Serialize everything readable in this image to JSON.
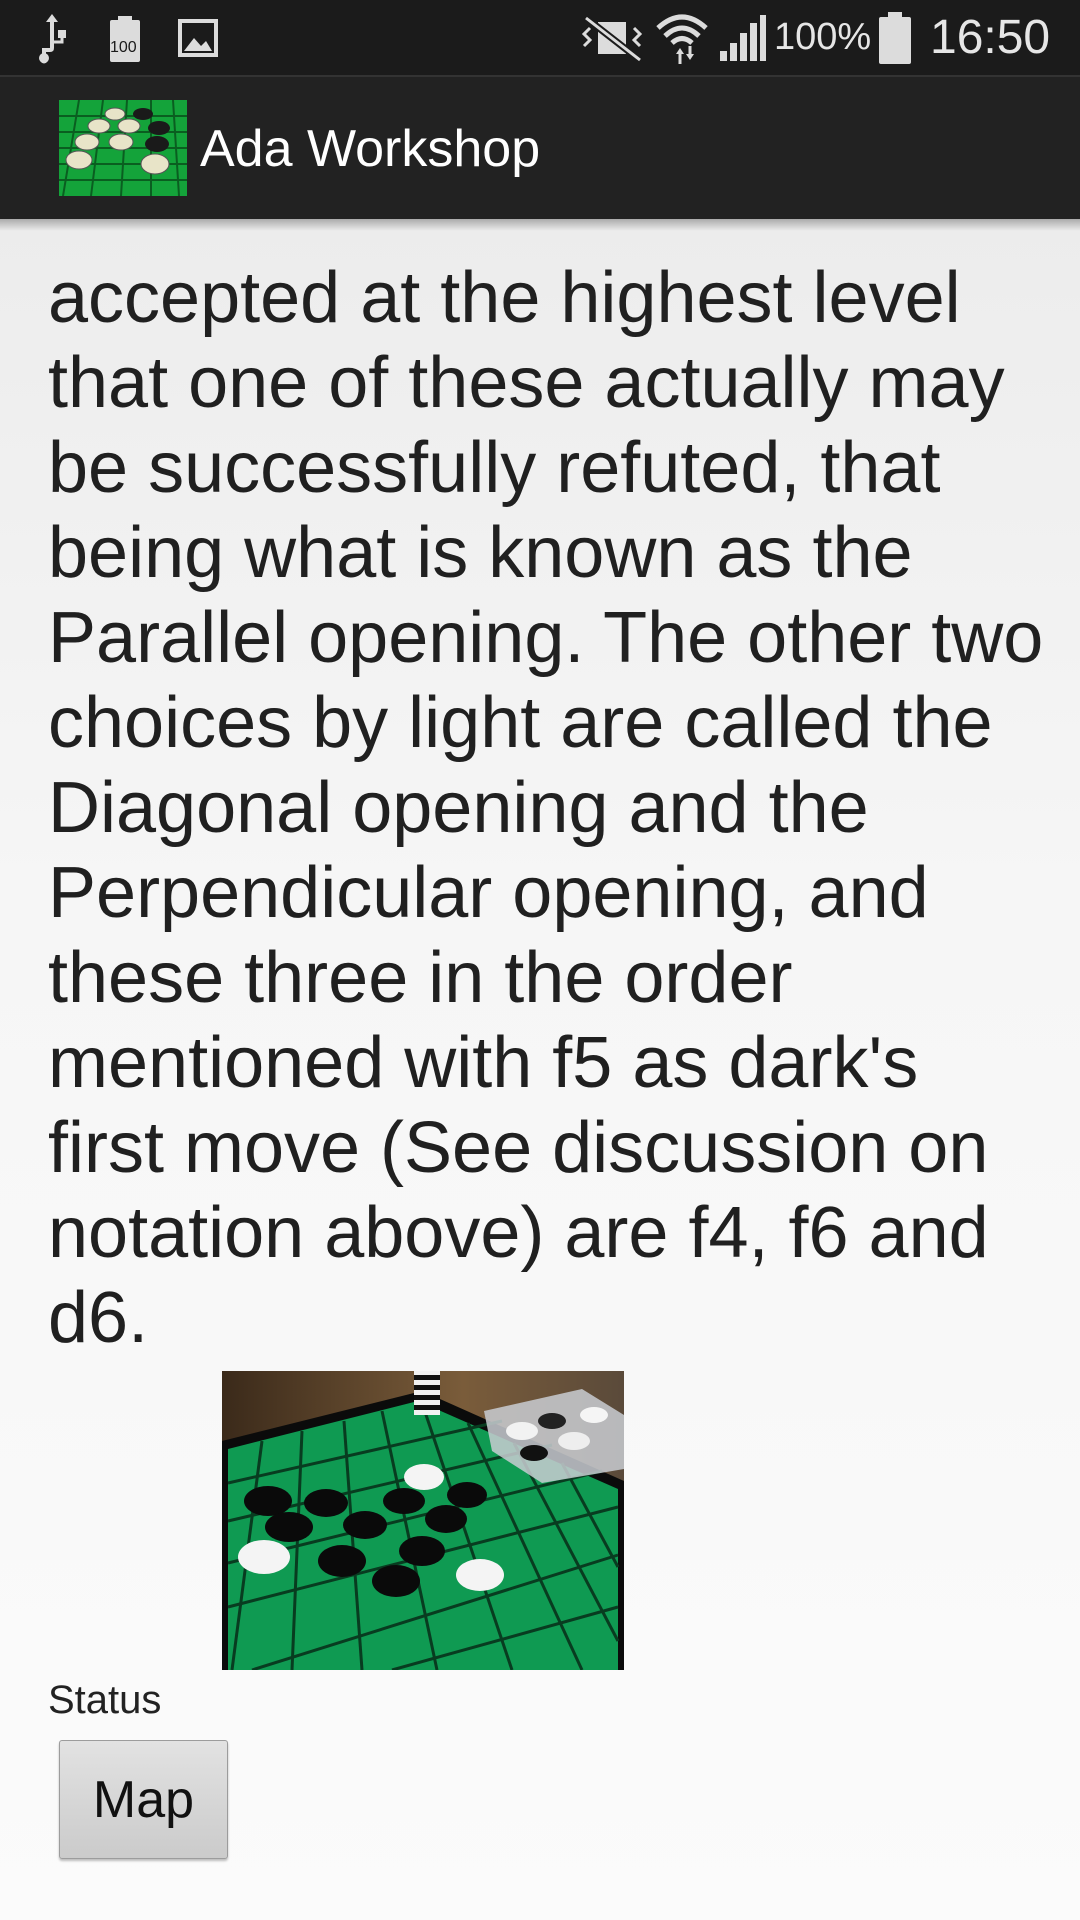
{
  "status_bar": {
    "icons": [
      "usb-icon",
      "battery-saver-icon",
      "image-icon",
      "vibrate-mute-icon",
      "wifi-icon",
      "signal-icon",
      "battery-icon"
    ],
    "battery_saver_label": "100",
    "battery_percent": "100%",
    "time": "16:50"
  },
  "action_bar": {
    "title": "Ada Workshop",
    "logo_icon": "othello-board-icon"
  },
  "article": {
    "text": "accepted at the highest level that one of these actually may be successfully refuted, that being what is known as the Parallel opening. The other two choices by light are called the Diagonal opening and the Perpendicular opening, and these three in the order mentioned with f5 as dark's first move (See discussion on notation above) are f4, f6 and d6."
  },
  "photo": {
    "icon": "othello-board-photo"
  },
  "footer": {
    "status_label": "Status",
    "map_button_label": "Map"
  },
  "colors": {
    "status_bar_bg": "#1b1b1b",
    "action_bar_bg": "#222222",
    "board_green": "#0f8f3c",
    "text": "#202020"
  }
}
